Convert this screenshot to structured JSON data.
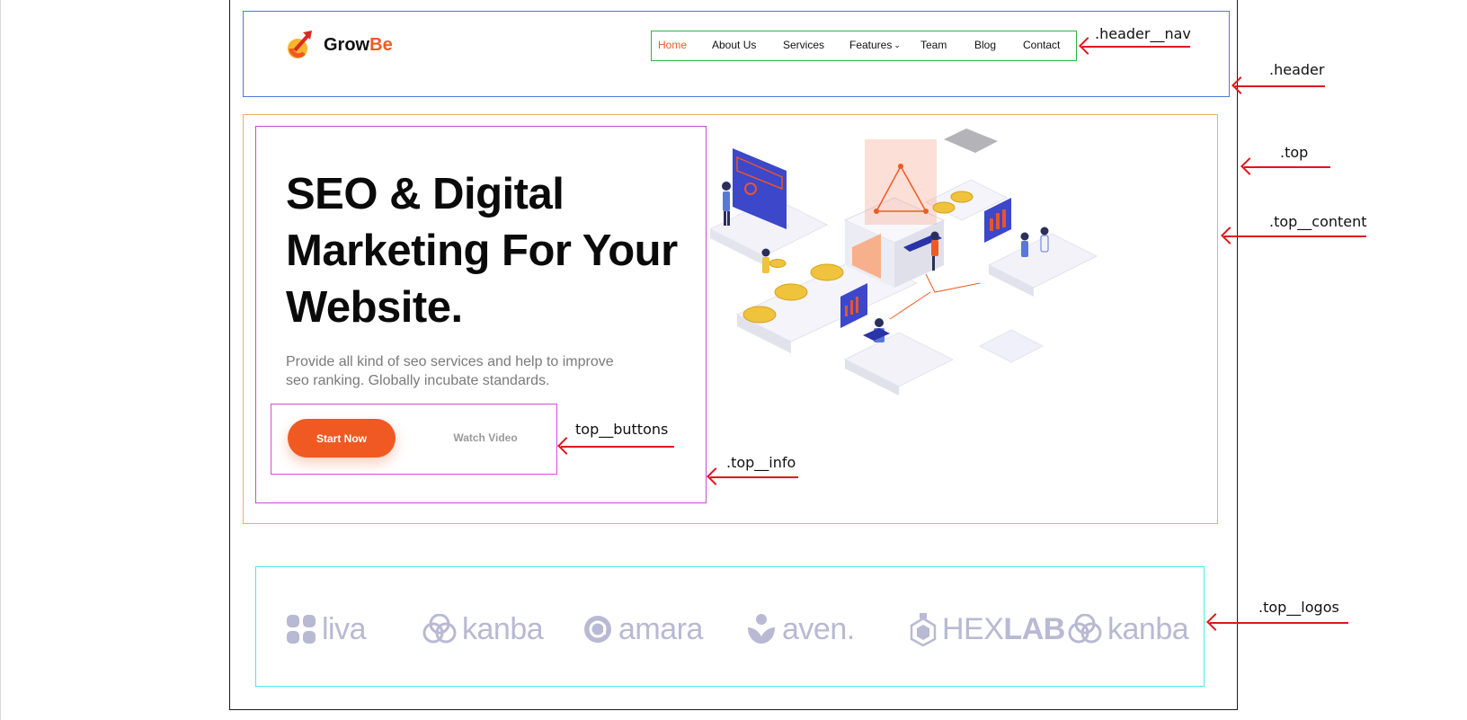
{
  "brand": {
    "name_first": "Grow",
    "name_accent": "Be"
  },
  "nav": {
    "items": [
      {
        "label": "Home",
        "active": true
      },
      {
        "label": "About Us"
      },
      {
        "label": "Services"
      },
      {
        "label": "Features",
        "has_dropdown": true
      },
      {
        "label": "Team"
      },
      {
        "label": "Blog"
      },
      {
        "label": "Contact"
      }
    ]
  },
  "hero": {
    "title_line1": "SEO & Digital",
    "title_line2": "Marketing For Your",
    "title_line3": "Website.",
    "desc_line1": "Provide all kind of seo services and help to improve",
    "desc_line2": "seo ranking. Globally incubate standards.",
    "primary_button": "Start Now",
    "secondary_button": "Watch Video"
  },
  "partners": [
    {
      "name": "liva",
      "icon": "liva-logo-icon"
    },
    {
      "name": "kanba",
      "icon": "kanba-logo-icon"
    },
    {
      "name": "amara",
      "icon": "amara-logo-icon"
    },
    {
      "name": "aven.",
      "icon": "aven-logo-icon"
    },
    {
      "name": "HEX",
      "suffix": "LAB",
      "icon": "hexlab-logo-icon"
    },
    {
      "name": "kanba",
      "icon": "kanba-logo-icon"
    }
  ],
  "annotations": {
    "header_nav": ".header__nav",
    "header": ".header",
    "top": ".top",
    "top_content": ".top__content",
    "top_buttons": "top__buttons",
    "top_info": ".top__info",
    "top_logos": ".top__logos"
  },
  "colors": {
    "accent": "#f05a22",
    "text": "#111111",
    "muted": "#7a7a7a",
    "logo_gray": "#b8b9d2",
    "annotation_arrow": "#e0151b",
    "box_header": "#4a7bdc",
    "box_nav": "#33b249",
    "box_top": "#f0b05a",
    "box_info": "#c44bd8",
    "box_logos": "#4fe6e6"
  }
}
